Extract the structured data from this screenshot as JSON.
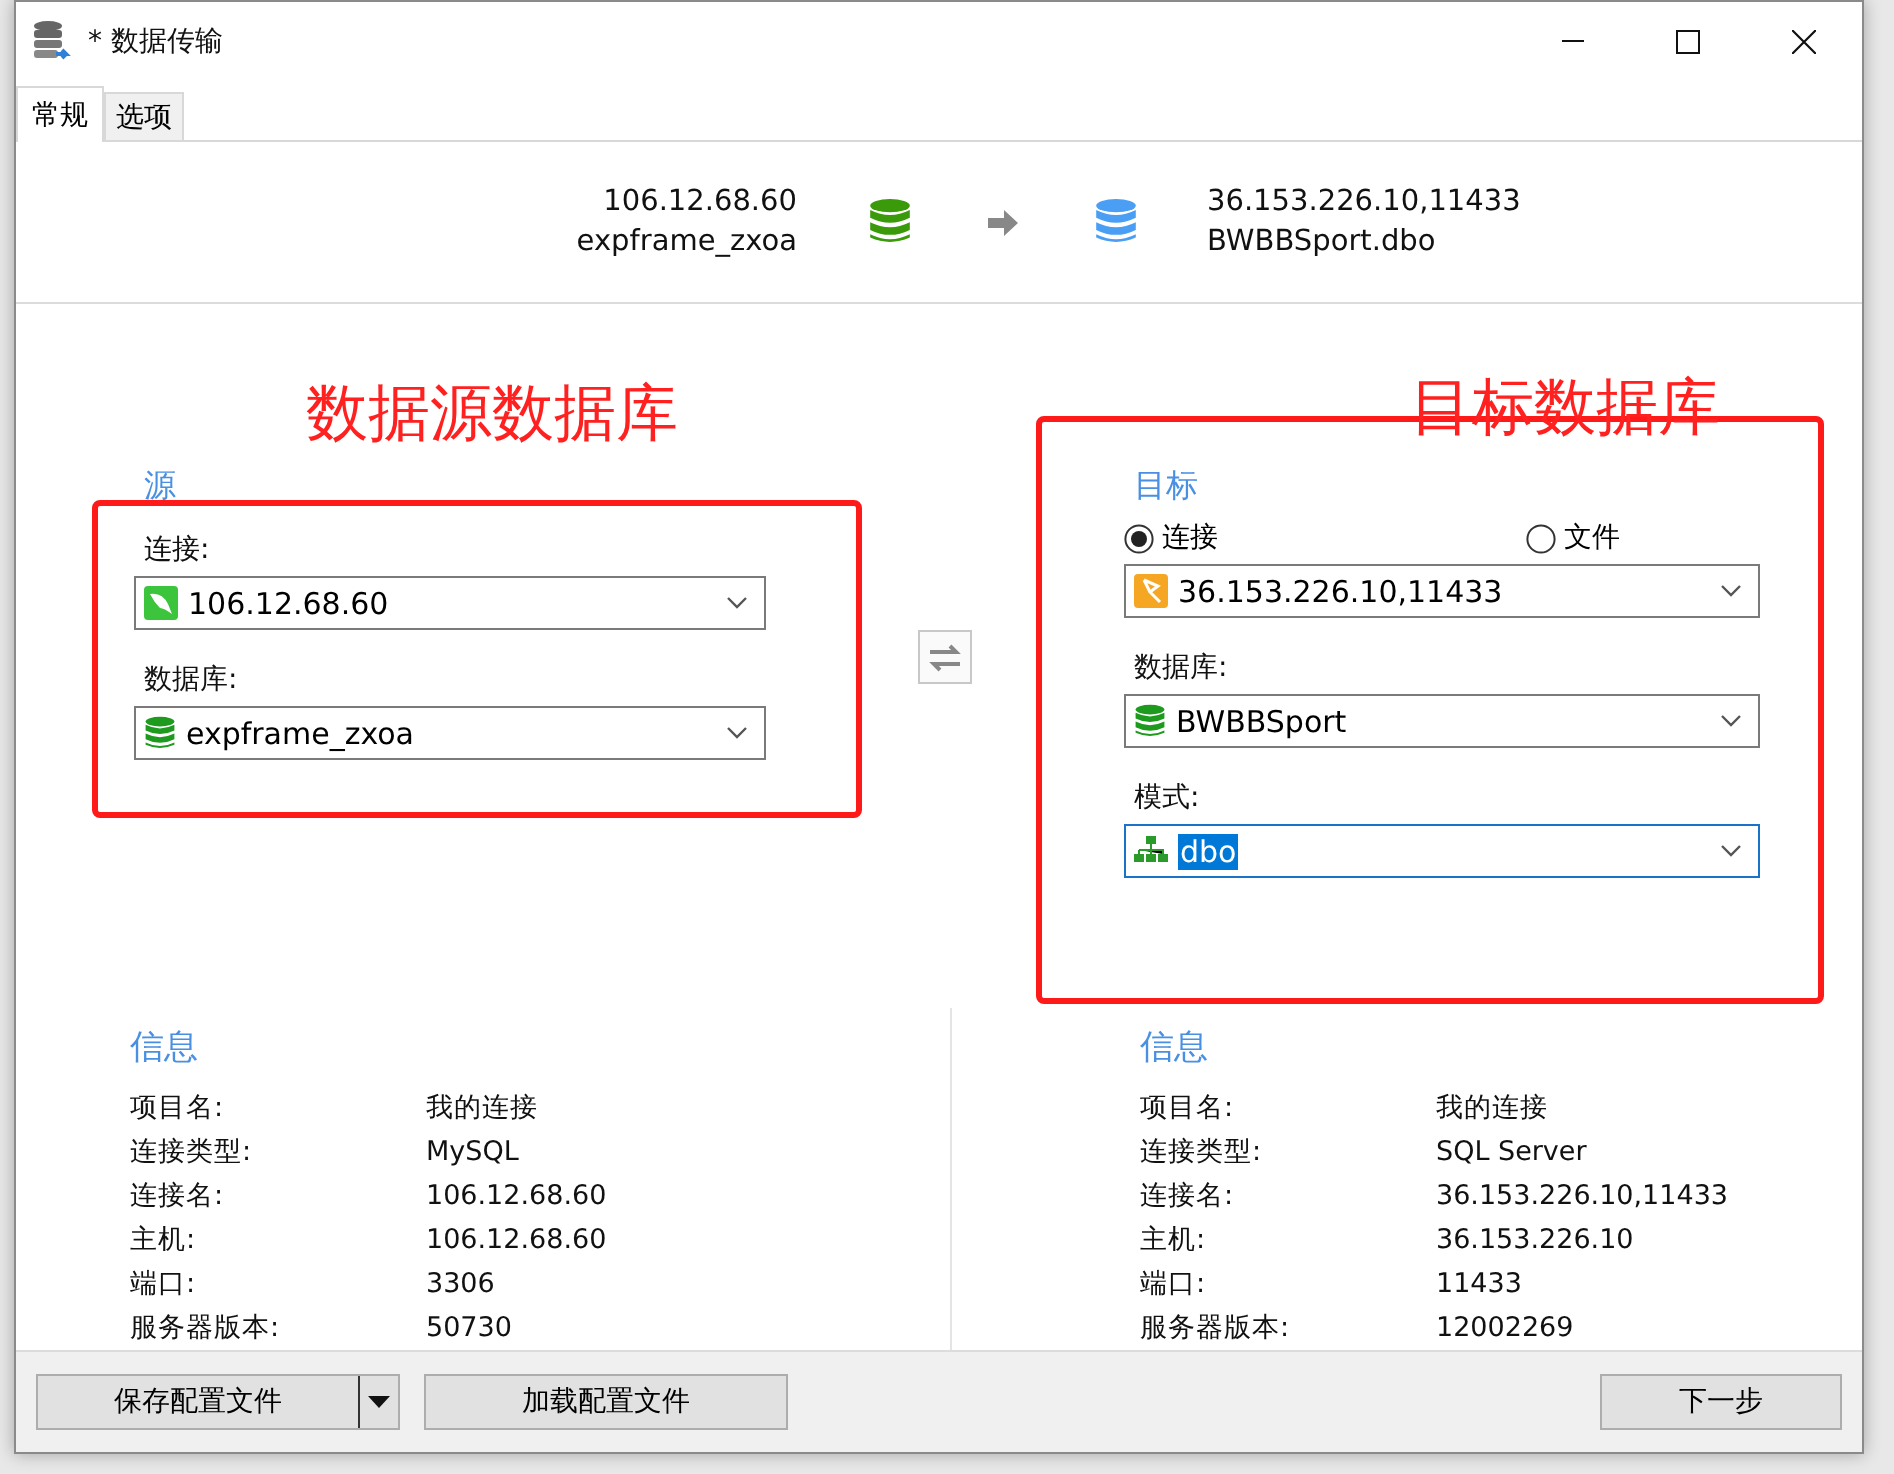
{
  "window": {
    "title": "* 数据传输"
  },
  "tabs": [
    {
      "label": "常规",
      "selected": true
    },
    {
      "label": "选项",
      "selected": false
    }
  ],
  "transfer_header": {
    "source": {
      "host": "106.12.68.60",
      "database": "expframe_zxoa"
    },
    "target": {
      "host": "36.153.226.10,11433",
      "database": "BWBBSport.dbo"
    }
  },
  "annotations": [
    {
      "text": "数据源数据库"
    },
    {
      "text": "目标数据库"
    }
  ],
  "source": {
    "title": "源",
    "connection_label": "连接:",
    "connection": "106.12.68.60",
    "database_label": "数据库:",
    "database": "expframe_zxoa"
  },
  "target": {
    "title": "目标",
    "modes": [
      {
        "label": "连接",
        "selected": true
      },
      {
        "label": "文件",
        "selected": false
      }
    ],
    "connection": "36.153.226.10,11433",
    "database_label": "数据库:",
    "database": "BWBBSport",
    "schema_label": "模式:",
    "schema": "dbo"
  },
  "source_info": {
    "title": "信息",
    "rows": [
      {
        "label": "项目名:",
        "value": "我的连接"
      },
      {
        "label": "连接类型:",
        "value": "MySQL"
      },
      {
        "label": "连接名:",
        "value": "106.12.68.60"
      },
      {
        "label": "主机:",
        "value": "106.12.68.60"
      },
      {
        "label": "端口:",
        "value": "3306"
      },
      {
        "label": "服务器版本:",
        "value": "50730"
      }
    ]
  },
  "target_info": {
    "title": "信息",
    "rows": [
      {
        "label": "项目名:",
        "value": "我的连接"
      },
      {
        "label": "连接类型:",
        "value": "SQL Server"
      },
      {
        "label": "连接名:",
        "value": "36.153.226.10,11433"
      },
      {
        "label": "主机:",
        "value": "36.153.226.10"
      },
      {
        "label": "端口:",
        "value": "11433"
      },
      {
        "label": "服务器版本:",
        "value": "12002269"
      }
    ]
  },
  "buttons": {
    "save": "保存配置文件",
    "load": "加载配置文件",
    "next": "下一步"
  }
}
